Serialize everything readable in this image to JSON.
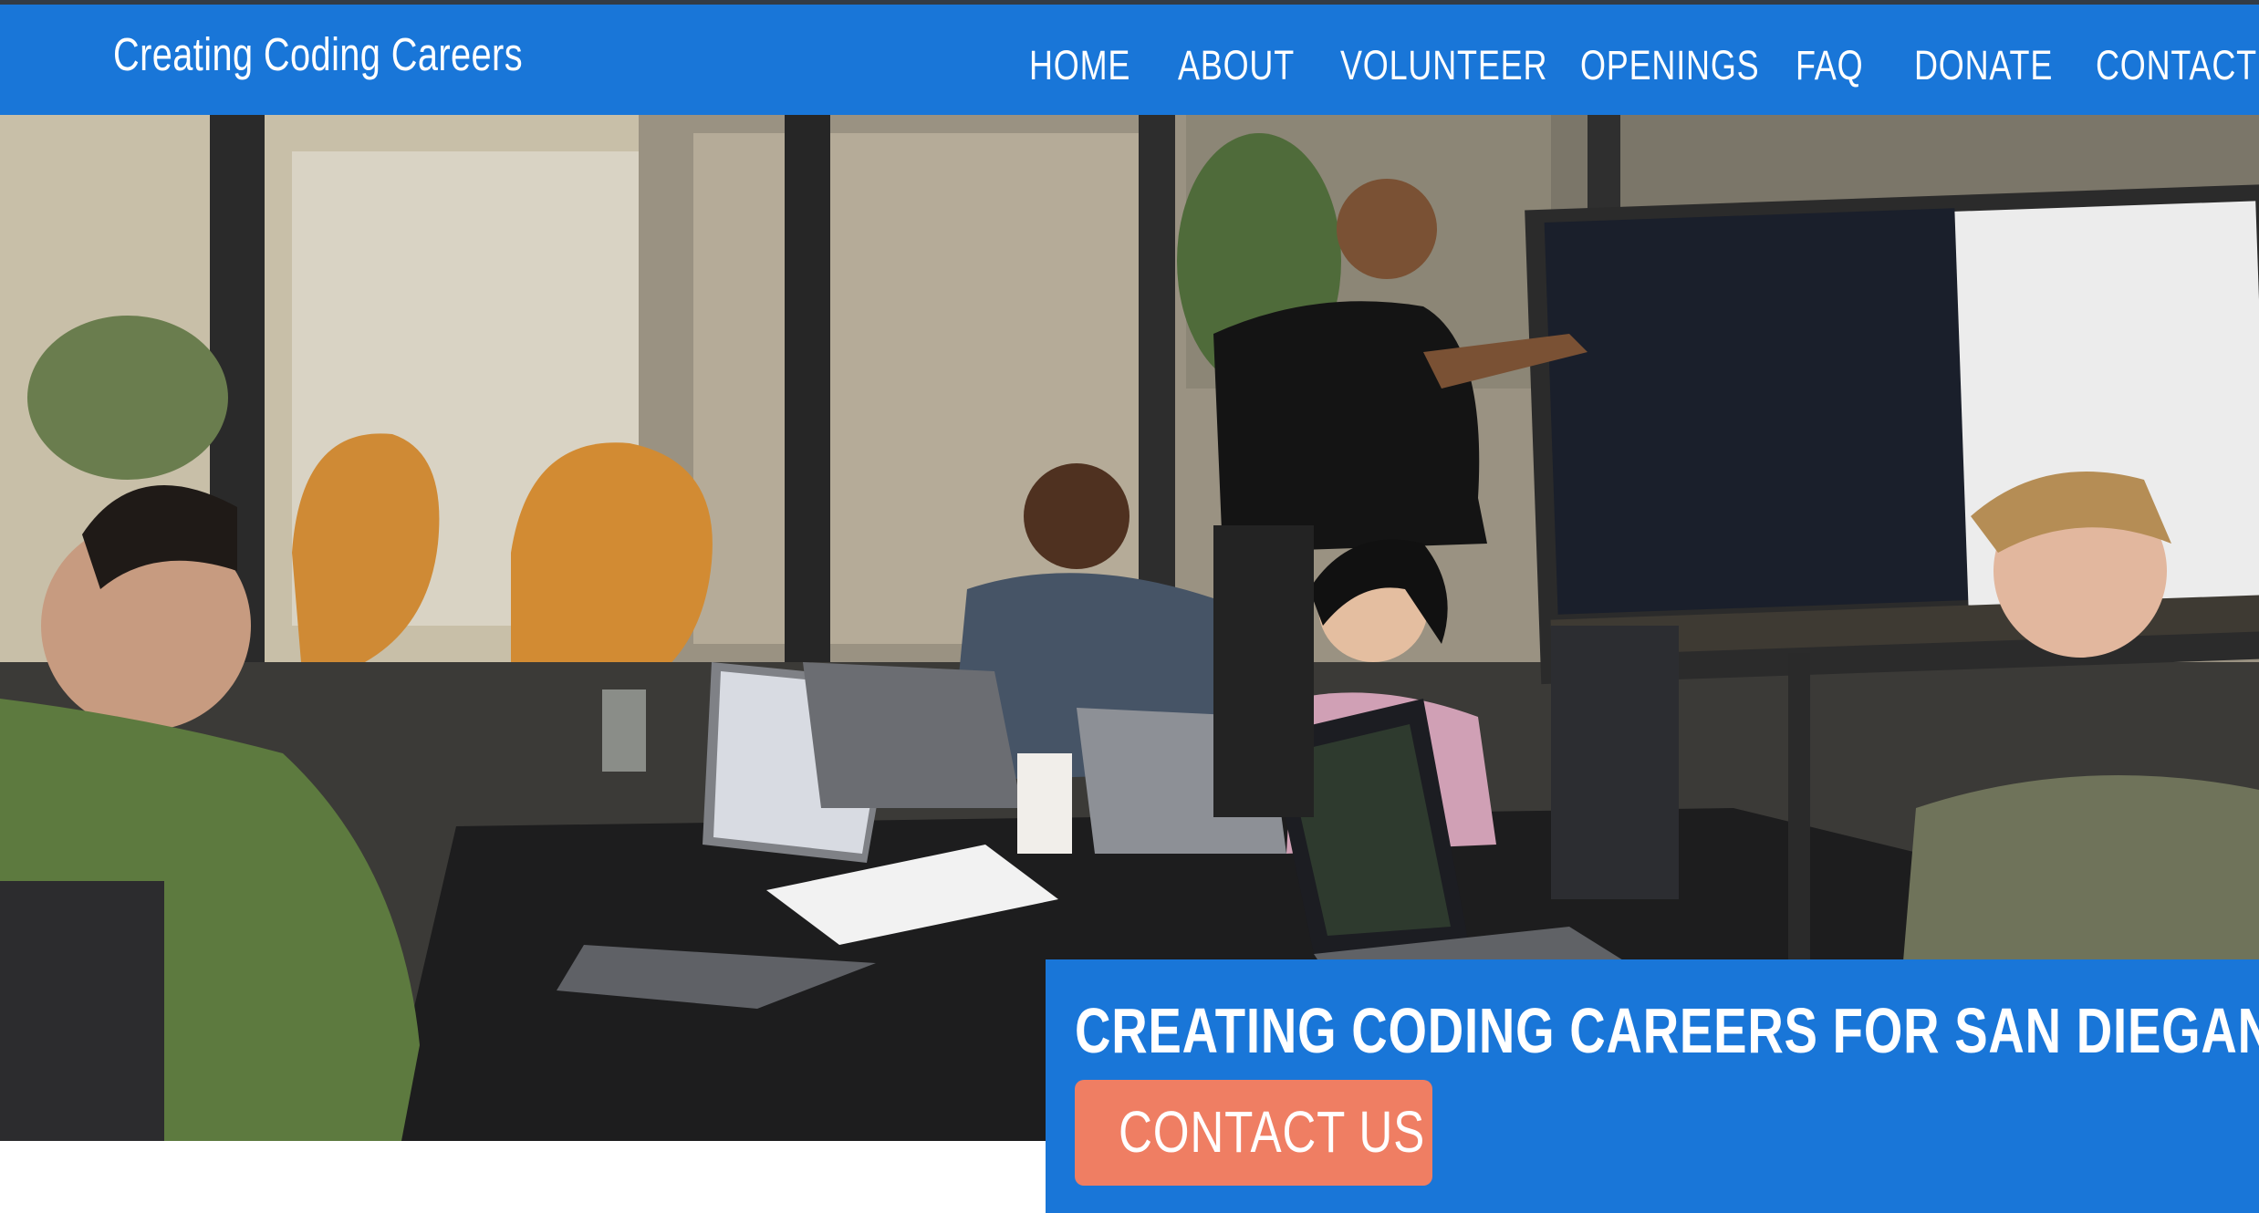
{
  "header": {
    "brand": "Creating Coding Careers",
    "nav": [
      "HOME",
      "ABOUT",
      "VOLUNTEER",
      "OPENINGS",
      "FAQ",
      "DONATE",
      "CONTACT"
    ]
  },
  "hero": {
    "image": "team-coding-photo",
    "heading": "CREATING CODING CAREERS FOR SAN DIEGANS",
    "button_label": "CONTACT US"
  },
  "colors": {
    "primary_blue": "#1976d8",
    "accent_coral": "#ef7e63",
    "text_white": "#ffffff"
  }
}
